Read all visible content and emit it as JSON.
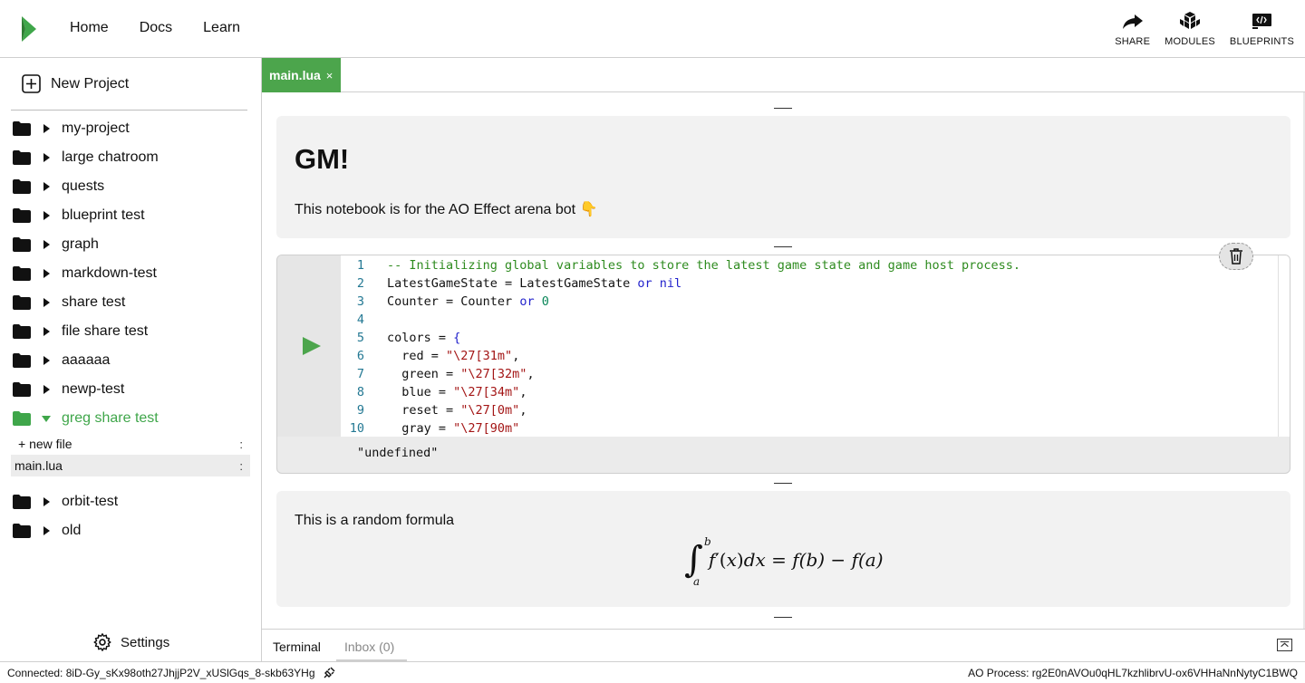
{
  "nav": {
    "home": "Home",
    "docs": "Docs",
    "learn": "Learn"
  },
  "toolbar": {
    "share": "SHARE",
    "modules": "MODULES",
    "blueprints": "BLUEPRINTS"
  },
  "colors": {
    "accent": "#4ca54c",
    "folder_active": "#3fa64a"
  },
  "sidebar": {
    "new_project": "New Project",
    "folders_top": [
      "my-project",
      "large chatroom",
      "quests",
      "blueprint test",
      "graph",
      "markdown-test",
      "share test",
      "file share test",
      "aaaaaa",
      "newp-test"
    ],
    "active_folder": "greg share test",
    "new_file": "+ new file",
    "file_selected": "main.lua",
    "menu_dots": ":",
    "folders_bottom": [
      "orbit-test",
      "old"
    ],
    "settings": "Settings"
  },
  "editor_tab": {
    "label": "main.lua",
    "close": "×"
  },
  "cell1": {
    "title": "GM!",
    "text": "This notebook is for the AO Effect arena bot 👇"
  },
  "code": {
    "line_numbers": [
      "1",
      "2",
      "3",
      "4",
      "5",
      "6",
      "7",
      "8",
      "9",
      "10"
    ],
    "output": "\"undefined\""
  },
  "cell3": {
    "text": "This is a random formula",
    "formula": {
      "f": "f",
      "prime": "′(",
      "x": "x",
      "close": ")",
      "dx": "dx",
      "eq": " = ",
      "fb": "f(b)",
      "minus": " − ",
      "fa": "f(a)",
      "lower": "a",
      "upper": "b",
      "integral": "∫"
    }
  },
  "terminal": {
    "tab_terminal": "Terminal",
    "tab_inbox": "Inbox (0)"
  },
  "status": {
    "connected": "Connected: 8iD-Gy_sKx98oth27JhjjP2V_xUSlGqs_8-skb63YHg",
    "ao_process": "AO Process: rg2E0nAVOu0qHL7kzhlibrvU-ox6VHHaNnNytyC1BWQ"
  }
}
